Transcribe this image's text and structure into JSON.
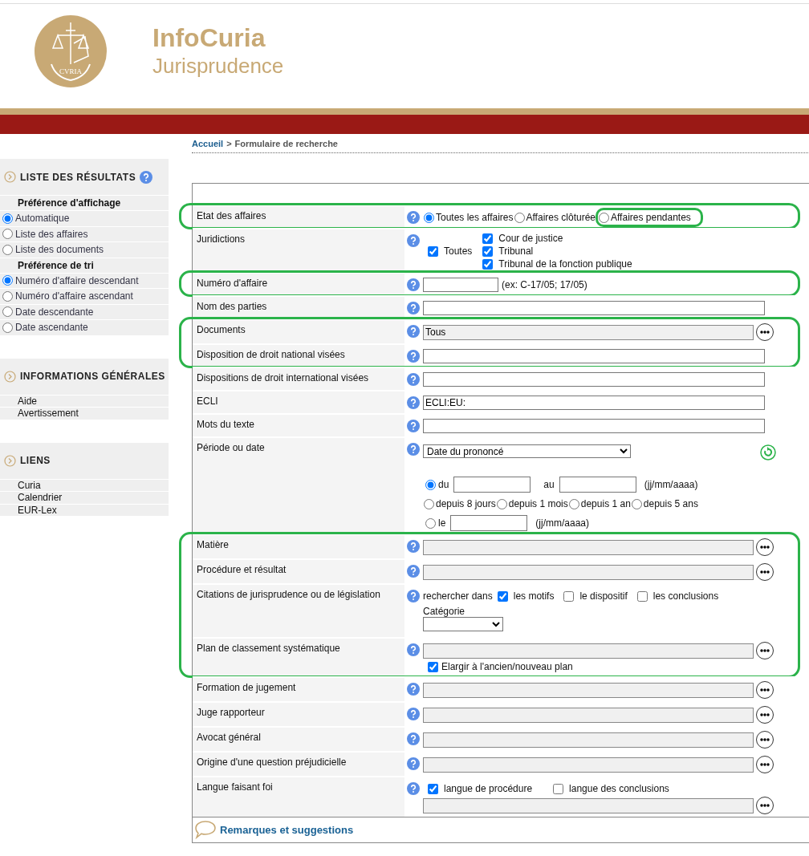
{
  "header": {
    "logo_text": "CVRIA",
    "title": "InfoCuria",
    "subtitle": "Jurisprudence"
  },
  "breadcrumb": {
    "home": "Accueil",
    "separator": ">",
    "current": "Formulaire de recherche"
  },
  "sidebar": [
    {
      "title": "LISTE DES RÉSULTATS",
      "help": true,
      "groups": [
        {
          "heading": "Préférence d'affichage",
          "options": [
            {
              "label": "Automatique",
              "selected": true
            },
            {
              "label": "Liste des affaires",
              "selected": false
            },
            {
              "label": "Liste des documents",
              "selected": false
            }
          ]
        },
        {
          "heading": "Préférence de tri",
          "options": [
            {
              "label": "Numéro d'affaire descendant",
              "selected": true
            },
            {
              "label": "Numéro d'affaire ascendant",
              "selected": false
            },
            {
              "label": "Date descendante",
              "selected": false
            },
            {
              "label": "Date ascendante",
              "selected": false
            }
          ]
        }
      ]
    },
    {
      "title": "INFORMATIONS GÉNÉRALES",
      "help": false,
      "links": [
        "Aide",
        "Avertissement"
      ]
    },
    {
      "title": "LIENS",
      "help": false,
      "links": [
        "Curia",
        "Calendrier",
        "EUR-Lex"
      ]
    }
  ],
  "form": {
    "sections": [
      {
        "highlighted": true,
        "rows": [
          {
            "kind": "radios",
            "label": "Etat des affaires",
            "options": [
              {
                "label": "Toutes les affaires",
                "selected": true,
                "highlighted": false
              },
              {
                "label": "Affaires clôturée",
                "selected": false,
                "highlighted": false
              },
              {
                "label": "Affaires pendantes",
                "selected": false,
                "highlighted": true
              }
            ]
          }
        ]
      },
      {
        "highlighted": false,
        "rows": [
          {
            "kind": "courts",
            "label": "Juridictions",
            "all": {
              "label": "Toutes",
              "checked": true
            },
            "items": [
              {
                "label": "Cour de justice",
                "checked": true
              },
              {
                "label": "Tribunal",
                "checked": true
              },
              {
                "label": "Tribunal de la fonction publique",
                "checked": true
              }
            ]
          }
        ]
      },
      {
        "highlighted": true,
        "rows": [
          {
            "kind": "text",
            "label": "Numéro d'affaire",
            "hint": "(ex: C-17/05; 17/05)"
          }
        ]
      },
      {
        "highlighted": false,
        "rows": [
          {
            "kind": "text",
            "label": "Nom des parties"
          }
        ]
      },
      {
        "highlighted": true,
        "rows": [
          {
            "kind": "picker",
            "label": "Documents",
            "value": "Tous"
          },
          {
            "kind": "text",
            "label": "Disposition de droit national visées"
          }
        ]
      },
      {
        "highlighted": false,
        "rows": [
          {
            "kind": "text",
            "label": "Dispositions de droit international visées"
          },
          {
            "kind": "text",
            "label": "ECLI",
            "value": "ECLI:EU:"
          },
          {
            "kind": "text",
            "label": "Mots du texte"
          },
          {
            "kind": "period",
            "label": "Période ou date",
            "select": "Date du prononcé",
            "range": {
              "label": "du",
              "selected": true,
              "to": "au",
              "format": "(jj/mm/aaaa)"
            },
            "quick": [
              {
                "label": "depuis 8 jours",
                "selected": false
              },
              {
                "label": "depuis 1 mois",
                "selected": false
              },
              {
                "label": "depuis 1 an",
                "selected": false
              },
              {
                "label": "depuis 5 ans",
                "selected": false
              }
            ],
            "single": {
              "label": "le",
              "selected": false,
              "format": "(jj/mm/aaaa)"
            }
          }
        ]
      },
      {
        "highlighted": true,
        "rows": [
          {
            "kind": "picker",
            "label": "Matière"
          },
          {
            "kind": "picker",
            "label": "Procédure et résultat"
          },
          {
            "kind": "citations",
            "label": "Citations de jurisprudence ou de législation",
            "prefix": "rechercher dans",
            "checks": [
              {
                "label": "les motifs",
                "checked": true
              },
              {
                "label": "le dispositif",
                "checked": false
              },
              {
                "label": "les conclusions",
                "checked": false
              }
            ],
            "category": "Catégorie"
          },
          {
            "kind": "plan",
            "label": "Plan de classement systématique",
            "check": {
              "label": "Elargir à l'ancien/nouveau plan",
              "checked": true
            }
          }
        ]
      },
      {
        "highlighted": false,
        "rows": [
          {
            "kind": "picker",
            "label": "Formation de jugement"
          },
          {
            "kind": "picker",
            "label": "Juge rapporteur"
          },
          {
            "kind": "picker",
            "label": "Avocat général"
          },
          {
            "kind": "picker",
            "label": "Origine d'une question préjudicielle"
          },
          {
            "kind": "language",
            "label": "Langue faisant foi",
            "checks": [
              {
                "label": "langue de procédure",
                "checked": true
              },
              {
                "label": "langue des conclusions",
                "checked": false
              }
            ]
          }
        ]
      }
    ]
  },
  "footer": {
    "link": "Remarques et suggestions"
  }
}
